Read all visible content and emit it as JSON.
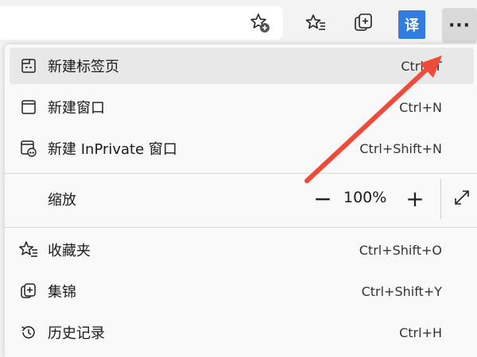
{
  "toolbar": {
    "icons": [
      "add-favorite-icon",
      "favorites-icon",
      "collections-icon",
      "translate-icon",
      "more-icon"
    ],
    "translate_label": "译",
    "more_label": "···",
    "translate_color": "#2f7de1"
  },
  "menu": {
    "items": [
      {
        "label": "新建标签页",
        "shortcut": "Ctrl+T",
        "icon": "new-tab-icon"
      },
      {
        "label": "新建窗口",
        "shortcut": "Ctrl+N",
        "icon": "new-window-icon"
      },
      {
        "label": "新建 InPrivate 窗口",
        "shortcut": "Ctrl+Shift+N",
        "icon": "inprivate-icon"
      }
    ],
    "zoom": {
      "label": "缩放",
      "value": "100%",
      "minus": "−",
      "plus": "+"
    },
    "items2": [
      {
        "label": "收藏夹",
        "shortcut": "Ctrl+Shift+O",
        "icon": "favorites-icon"
      },
      {
        "label": "集锦",
        "shortcut": "Ctrl+Shift+Y",
        "icon": "collections-icon"
      },
      {
        "label": "历史记录",
        "shortcut": "Ctrl+H",
        "icon": "history-icon"
      }
    ]
  },
  "annotation": {
    "arrow_color": "#f04a3a"
  }
}
